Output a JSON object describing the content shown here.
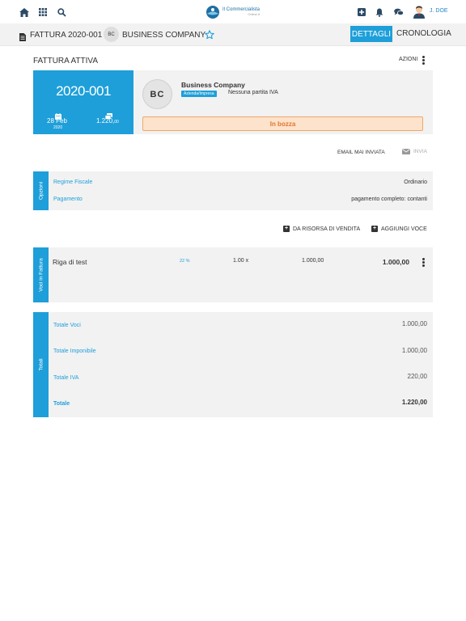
{
  "topbar": {
    "logo_title": "Il Commercialista",
    "logo_sub": "Online.it",
    "user_name": "J. DOE"
  },
  "subheader": {
    "doc_title": "FATTURA 2020-001",
    "avatar_initials": "BC",
    "company": "BUSINESS COMPANY",
    "tabs": [
      {
        "label": "DETTAGLI",
        "active": true
      },
      {
        "label": "CRONOLOGIA",
        "active": false
      }
    ]
  },
  "section": {
    "title": "FATTURA ATTIVA",
    "actions_label": "AZIONI"
  },
  "invoice": {
    "number": "2020-001",
    "date_main": "28 Feb",
    "date_year": "2020",
    "amount_main": "1.220,",
    "amount_cents": "00",
    "avatar_initials": "BC",
    "company_name": "Business Company",
    "company_type": "Azienda/Impresa",
    "vat_info": "Nessuna partita IVA",
    "status": "In bozza"
  },
  "email": {
    "status": "EMAIL MAI INVIATA",
    "send_label": "INVIA"
  },
  "options": {
    "side_label": "Opzioni",
    "rows": [
      {
        "label": "Regime Fiscale",
        "value": "Ordinario"
      },
      {
        "label": "Pagamento",
        "value": "pagamento completo: contanti"
      }
    ]
  },
  "actions": {
    "from_resource": "DA RISORSA DI VENDITA",
    "add_item": "AGGIUNGI VOCE"
  },
  "items": {
    "side_label": "Voci in Fattura",
    "rows": [
      {
        "description": "Riga di test",
        "vat": "22 %",
        "qty": "1.00 x",
        "price": "1.000,00",
        "total": "1.000,00"
      }
    ]
  },
  "totals": {
    "side_label": "Totali",
    "rows": [
      {
        "label": "Totale Voci",
        "value": "1.000,00"
      },
      {
        "label": "Totale Imponibile",
        "value": "1.000,00"
      },
      {
        "label": "Totale IVA",
        "value": "220,00"
      },
      {
        "label": "Totale",
        "value": "1.220,00"
      }
    ]
  },
  "colors": {
    "accent": "#1e9fd9",
    "panel": "#f2f2f2",
    "draft_bg": "#fde2cc",
    "draft_text": "#e2762a"
  }
}
